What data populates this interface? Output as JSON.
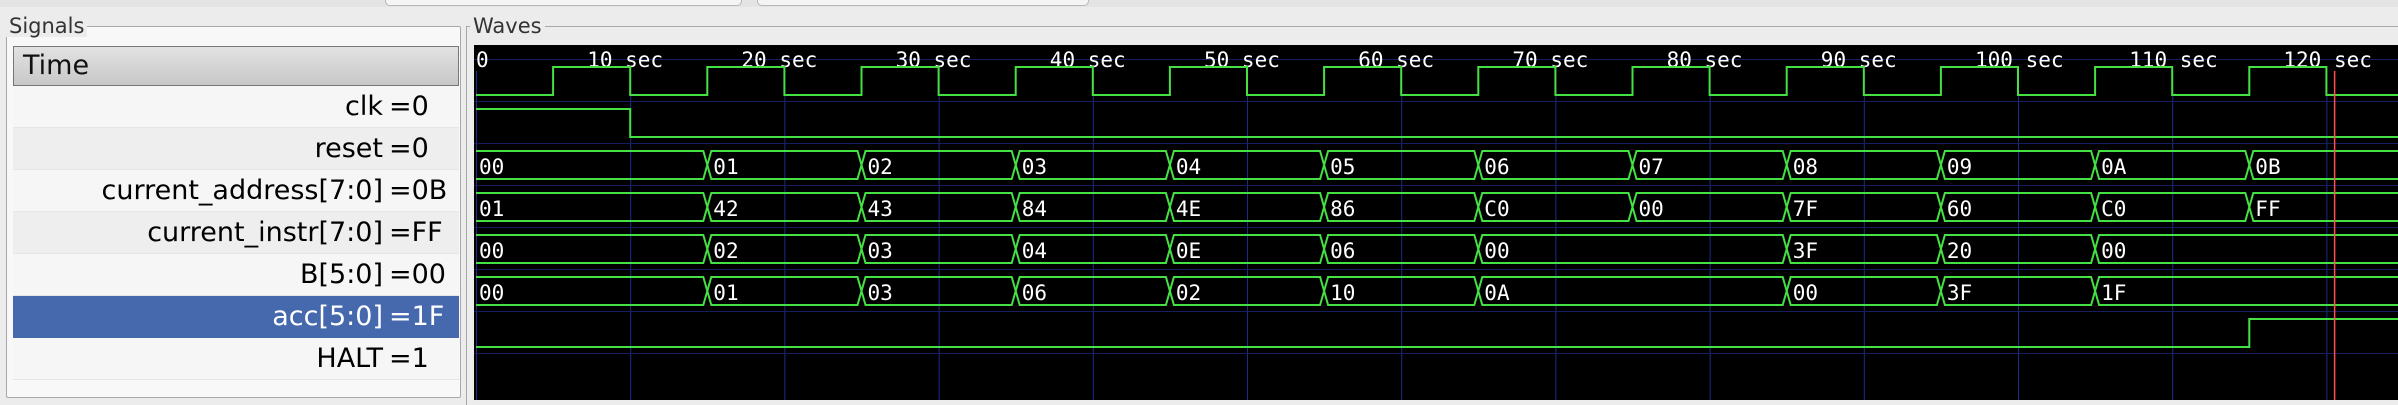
{
  "window": {
    "signals_pane_title": "Signals",
    "waves_pane_title": "Waves"
  },
  "signals": {
    "time_header": "Time",
    "rows": [
      {
        "name": "clk",
        "value": "=0",
        "selected": false
      },
      {
        "name": "reset",
        "value": "=0",
        "selected": false
      },
      {
        "name": "current_address[7:0]",
        "value": "=0B",
        "selected": false
      },
      {
        "name": "current_instr[7:0]",
        "value": "=FF",
        "selected": false
      },
      {
        "name": "B[5:0]",
        "value": "=00",
        "selected": false
      },
      {
        "name": "acc[5:0]",
        "value": "=1F",
        "selected": true
      },
      {
        "name": "HALT",
        "value": "=1",
        "selected": false
      }
    ]
  },
  "waves": {
    "time_unit": "sec",
    "ruler": {
      "labels": [
        "0",
        "10 sec",
        "20 sec",
        "30 sec",
        "40 sec",
        "50 sec",
        "60 sec",
        "70 sec",
        "80 sec",
        "90 sec",
        "100 sec",
        "110 sec",
        "120 sec"
      ],
      "label_times": [
        0,
        10,
        20,
        30,
        40,
        50,
        60,
        70,
        80,
        90,
        100,
        110,
        120
      ],
      "view_start": 0,
      "view_end": 125
    },
    "cursor_time": 120.5,
    "colors": {
      "background": "#000000",
      "trace": "#44e044",
      "grid": "#1e2a8a",
      "ruler_text": "#ffffff",
      "value_text": "#ffffff",
      "cursor": "#ff5050"
    },
    "clock": {
      "period": 10,
      "first_rise": 5,
      "initial": 0
    },
    "reset": {
      "initial": 1,
      "fall_time": 10
    },
    "halt": {
      "initial": 0,
      "rise_time": 115
    },
    "buses": [
      {
        "signal": "current_address[7:0]",
        "segments": [
          {
            "t": 0,
            "v": "00"
          },
          {
            "t": 15,
            "v": "01"
          },
          {
            "t": 25,
            "v": "02"
          },
          {
            "t": 35,
            "v": "03"
          },
          {
            "t": 45,
            "v": "04"
          },
          {
            "t": 55,
            "v": "05"
          },
          {
            "t": 65,
            "v": "06"
          },
          {
            "t": 75,
            "v": "07"
          },
          {
            "t": 85,
            "v": "08"
          },
          {
            "t": 95,
            "v": "09"
          },
          {
            "t": 105,
            "v": "0A"
          },
          {
            "t": 115,
            "v": "0B"
          }
        ]
      },
      {
        "signal": "current_instr[7:0]",
        "segments": [
          {
            "t": 0,
            "v": "01"
          },
          {
            "t": 15,
            "v": "42"
          },
          {
            "t": 25,
            "v": "43"
          },
          {
            "t": 35,
            "v": "84"
          },
          {
            "t": 45,
            "v": "4E"
          },
          {
            "t": 55,
            "v": "86"
          },
          {
            "t": 65,
            "v": "C0"
          },
          {
            "t": 75,
            "v": "00"
          },
          {
            "t": 85,
            "v": "7F"
          },
          {
            "t": 95,
            "v": "60"
          },
          {
            "t": 105,
            "v": "C0"
          },
          {
            "t": 115,
            "v": "FF"
          }
        ]
      },
      {
        "signal": "B[5:0]",
        "segments": [
          {
            "t": 0,
            "v": "00"
          },
          {
            "t": 15,
            "v": "02"
          },
          {
            "t": 25,
            "v": "03"
          },
          {
            "t": 35,
            "v": "04"
          },
          {
            "t": 45,
            "v": "0E"
          },
          {
            "t": 55,
            "v": "06"
          },
          {
            "t": 65,
            "v": "00"
          },
          {
            "t": 85,
            "v": "3F"
          },
          {
            "t": 95,
            "v": "20"
          },
          {
            "t": 105,
            "v": "00"
          }
        ]
      },
      {
        "signal": "acc[5:0]",
        "segments": [
          {
            "t": 0,
            "v": "00"
          },
          {
            "t": 15,
            "v": "01"
          },
          {
            "t": 25,
            "v": "03"
          },
          {
            "t": 35,
            "v": "06"
          },
          {
            "t": 45,
            "v": "02"
          },
          {
            "t": 55,
            "v": "10"
          },
          {
            "t": 65,
            "v": "0A"
          },
          {
            "t": 85,
            "v": "00"
          },
          {
            "t": 95,
            "v": "3F"
          },
          {
            "t": 105,
            "v": "1F"
          }
        ]
      }
    ]
  }
}
